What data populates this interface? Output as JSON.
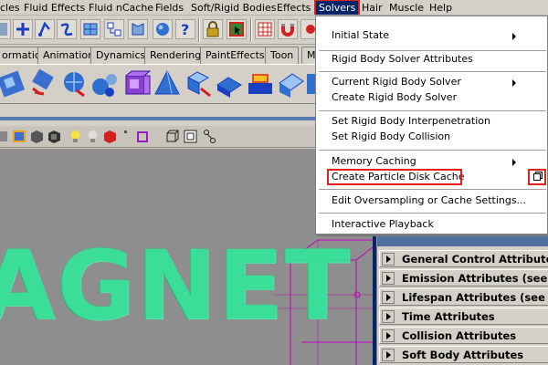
{
  "menubar": {
    "items": [
      {
        "label": "cles"
      },
      {
        "label": "Fluid Effects"
      },
      {
        "label": "Fluid nCache"
      },
      {
        "label": "Fields"
      },
      {
        "label": "Soft/Rigid Bodies"
      },
      {
        "label": "Effects"
      },
      {
        "label": "Solvers"
      },
      {
        "label": "Hair"
      },
      {
        "label": "Muscle"
      },
      {
        "label": "Help"
      }
    ]
  },
  "shelf": {
    "tabs": [
      {
        "label": "ormation"
      },
      {
        "label": "Animation"
      },
      {
        "label": "Dynamics"
      },
      {
        "label": "Rendering"
      },
      {
        "label": "PaintEffects"
      },
      {
        "label": "Toon"
      },
      {
        "label": "M"
      }
    ]
  },
  "solvers_menu": {
    "items": [
      {
        "label": "Initial State",
        "submenu": true
      },
      {
        "label": "Rigid Body Solver Attributes"
      },
      {
        "label": "Current Rigid Body Solver",
        "submenu": true
      },
      {
        "label": "Create Rigid Body Solver"
      },
      {
        "label": "Set Rigid Body Interpenetration"
      },
      {
        "label": "Set Rigid Body Collision"
      },
      {
        "label": "Memory Caching",
        "submenu": true
      },
      {
        "label": "Create Particle Disk Cache",
        "highlighted": true
      },
      {
        "label": "Edit Oversampling or Cache Settings..."
      },
      {
        "label": "Interactive Playback"
      }
    ]
  },
  "viewport": {
    "text": "AGNET"
  },
  "attribute_editor": {
    "sections": [
      {
        "label": "General Control Attributes"
      },
      {
        "label": "Emission Attributes (see also"
      },
      {
        "label": "Lifespan Attributes (see also"
      },
      {
        "label": "Time Attributes"
      },
      {
        "label": "Collision Attributes"
      },
      {
        "label": "Soft Body Attributes"
      }
    ]
  },
  "colors": {
    "highlight_outline": "#e0201a",
    "menu_selected": "#0a246a",
    "particle_text": "#37e39a",
    "viewport_bg": "#8e8e8e",
    "wireframe": "#c000c0"
  }
}
